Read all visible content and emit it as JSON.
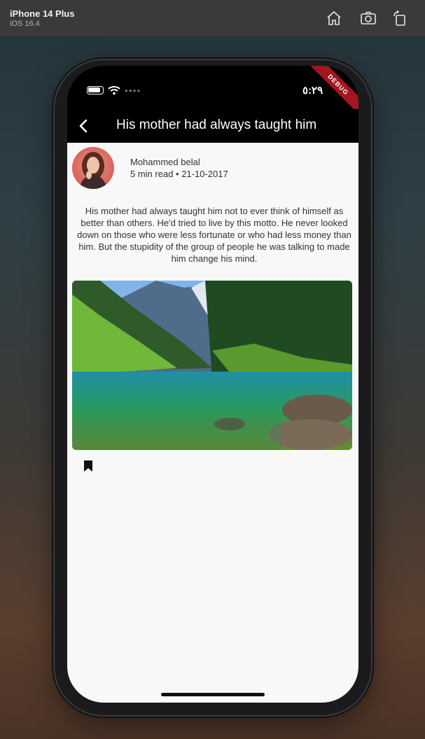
{
  "simulator": {
    "device": "iPhone 14 Plus",
    "os": "iOS 16.4",
    "icons": [
      "home-icon",
      "screenshot-icon",
      "rotate-icon"
    ]
  },
  "status_bar": {
    "time": "٥:٢٩",
    "debug_label": "DEBUG"
  },
  "appbar": {
    "title": "His mother had always taught him",
    "back_icon": "chevron-left-icon"
  },
  "article": {
    "author": "Mohammed belal",
    "meta": "5 min read • 21-10-2017",
    "body": "His mother had always taught him not to ever think of himself as better than others. He'd tried to live by this motto. He never looked down on those who were less fortunate or who had less money than him. But the stupidity of the group of people he was talking to made him change his mind.",
    "bookmark_icon": "bookmark-icon"
  },
  "colors": {
    "appbar_bg": "#000000",
    "page_bg": "#f8f8f8",
    "debug_ribbon": "#a3151f"
  }
}
